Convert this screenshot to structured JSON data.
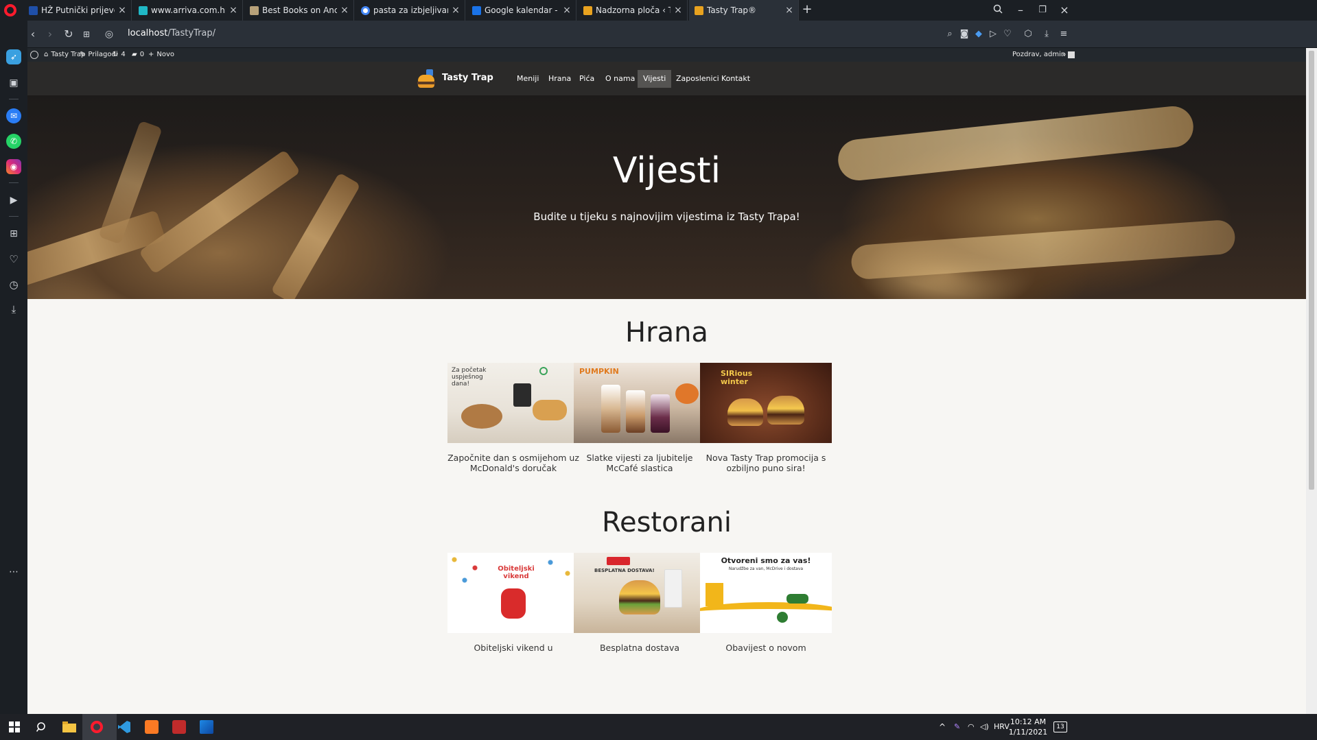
{
  "browser": {
    "tabs": [
      {
        "title": "HŽ Putnički prijevoz",
        "favicon_color": "#1f4fa8"
      },
      {
        "title": "www.arriva.com.hr",
        "favicon_color": "#20b8c6"
      },
      {
        "title": "Best Books on Ancient Gre",
        "favicon_color": "#b8a27a"
      },
      {
        "title": "pasta za izbjeljivanje zubi -",
        "favicon_color": "#4285f4"
      },
      {
        "title": "Google kalendar - Tjedan o",
        "favicon_color": "#1a73e8"
      },
      {
        "title": "Nadzorna ploča ‹ Tasty Tra",
        "favicon_color": "#e8a21f"
      },
      {
        "title": "Tasty Trap®",
        "favicon_color": "#e8a21f"
      }
    ],
    "url_host": "localhost",
    "url_path": "/TastyTrap/"
  },
  "wp_admin_bar": {
    "site_name": "Tasty Trap",
    "customize": "Prilagodi",
    "updates_count": "4",
    "comments_count": "0",
    "new_label": "Novo",
    "greeting": "Pozdrav, admin"
  },
  "site": {
    "brand": "Tasty Trap",
    "menu": [
      "Meniji",
      "Hrana",
      "Pića",
      "O nama",
      "Vijesti",
      "Zaposlenici",
      "Kontakt"
    ],
    "active_menu": "Vijesti"
  },
  "hero": {
    "title": "Vijesti",
    "subtitle": "Budite u tijeku s najnovijim vijestima iz Tasty Trapa!"
  },
  "sections": [
    {
      "title": "Hrana",
      "cards": [
        {
          "caption": "Započnite dan s osmijehom uz McDonald's doručak",
          "img_text": "Za početak uspješnog dana!"
        },
        {
          "caption": "Slatke vijesti za ljubitelje McCafé slastica",
          "img_text": "PUMPKIN"
        },
        {
          "caption": "Nova Tasty Trap promocija s ozbiljno puno sira!",
          "img_text": "SIRious winter"
        }
      ]
    },
    {
      "title": "Restorani",
      "cards": [
        {
          "caption": "Obiteljski vikend u",
          "img_text": "Obiteljski vikend"
        },
        {
          "caption": "Besplatna dostava",
          "img_text": "BESPLATNA DOSTAVA!"
        },
        {
          "caption": "Obavijest o novom",
          "img_text": "Otvoreni smo za vas!",
          "img_subtext": "Narudžbe za van, McDrive i dostava"
        }
      ]
    }
  ],
  "taskbar": {
    "language": "HRV",
    "time": "10:12 AM",
    "date": "1/11/2021",
    "notifications": "13"
  }
}
